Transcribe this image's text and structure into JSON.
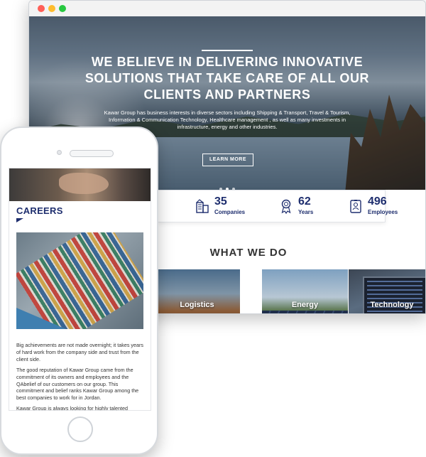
{
  "desktop": {
    "window_controls": [
      "close",
      "minimize",
      "maximize"
    ],
    "hero": {
      "title": "WE BELIEVE IN DELIVERING INNOVATIVE SOLUTIONS THAT TAKE CARE OF ALL OUR CLIENTS AND PARTNERS",
      "description": "Kawar Group has business interests in diverse sectors including Shipping & Transport, Travel & Tourism, Information & Communication Technology, Healthcare management , as well as many investments in infrastructure, energy and other industries.",
      "button_label": "LEARN MORE",
      "slider_dots": 3,
      "active_dot": 2
    },
    "stats": [
      {
        "value": "35",
        "label": "Companies",
        "icon": "building-icon"
      },
      {
        "value": "62",
        "label": "Years",
        "icon": "award-ribbon-icon"
      },
      {
        "value": "496",
        "label": "Employees",
        "icon": "employee-badge-icon"
      }
    ],
    "what_we_do": {
      "title": "WHAT WE DO",
      "services": [
        {
          "label": "Logistics"
        },
        {
          "label": "Energy"
        },
        {
          "label": "Technology"
        }
      ]
    }
  },
  "mobile": {
    "section_title": "CAREERS",
    "paragraphs": [
      "Big achievements are not made overnight; it takes years of hard work from the company side and trust from the client side.",
      "The good reputation of Kawar Group came from the commitment of its owners and employees and the QAbelief of our customers on our group. This commitment and belief ranks Kawar Group among the best companies to work for in Jordan.",
      "Kawar Group is always looking for highly talented"
    ]
  },
  "colors": {
    "brand_navy": "#1e2e6e",
    "window_close": "#ff5f57",
    "window_minimize": "#febc2e",
    "window_maximize": "#28c840"
  }
}
